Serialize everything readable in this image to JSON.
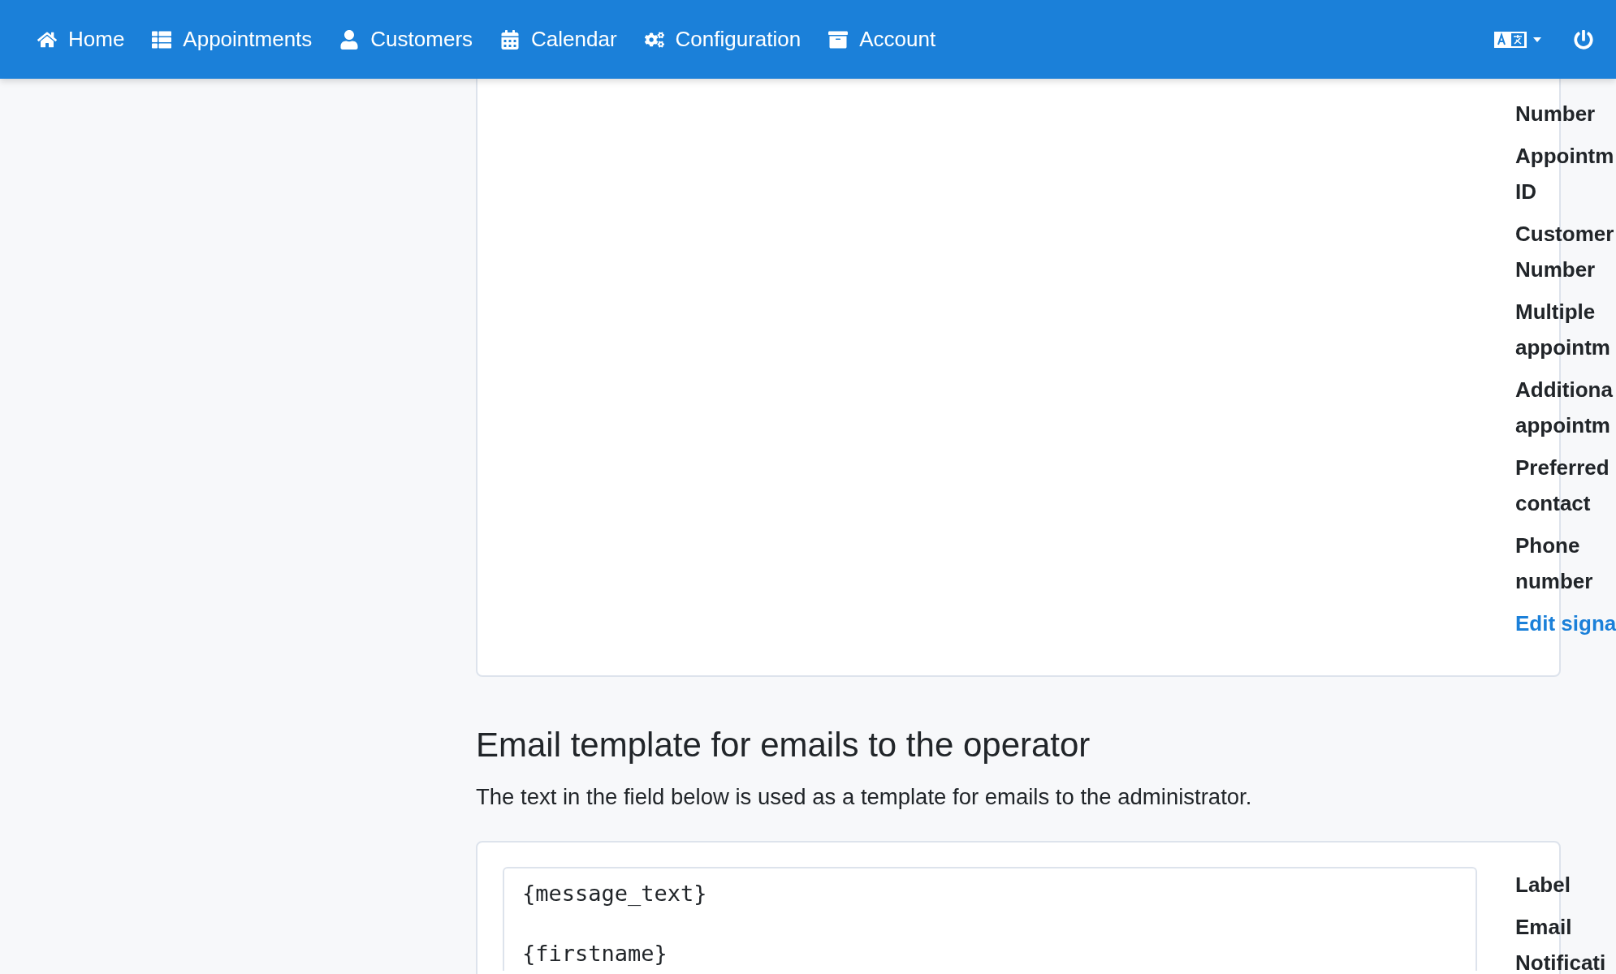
{
  "navbar": {
    "items": [
      {
        "label": "Home"
      },
      {
        "label": "Appointments"
      },
      {
        "label": "Customers"
      },
      {
        "label": "Calendar"
      },
      {
        "label": "Configuration"
      },
      {
        "label": "Account"
      }
    ]
  },
  "signature_card": {
    "placeholders": [
      {
        "lines": [
          "Number"
        ]
      },
      {
        "lines": [
          "Appointm",
          "ID"
        ]
      },
      {
        "lines": [
          "Customer",
          "Number"
        ]
      },
      {
        "lines": [
          "Multiple",
          "appointm"
        ]
      },
      {
        "lines": [
          "Additiona",
          "appointm"
        ]
      },
      {
        "lines": [
          "Preferred",
          "contact"
        ]
      },
      {
        "lines": [
          "Phone",
          "number"
        ]
      }
    ],
    "link": "Edit signa"
  },
  "operator_section": {
    "heading": "Email template for emails to the operator",
    "description": "The text in the field below is used as a template for emails to the administrator.",
    "template": "{message_text}\n\n{firstname}",
    "placeholders": [
      {
        "lines": [
          "Label"
        ]
      },
      {
        "lines": [
          "Email",
          "Notificati"
        ]
      }
    ]
  }
}
